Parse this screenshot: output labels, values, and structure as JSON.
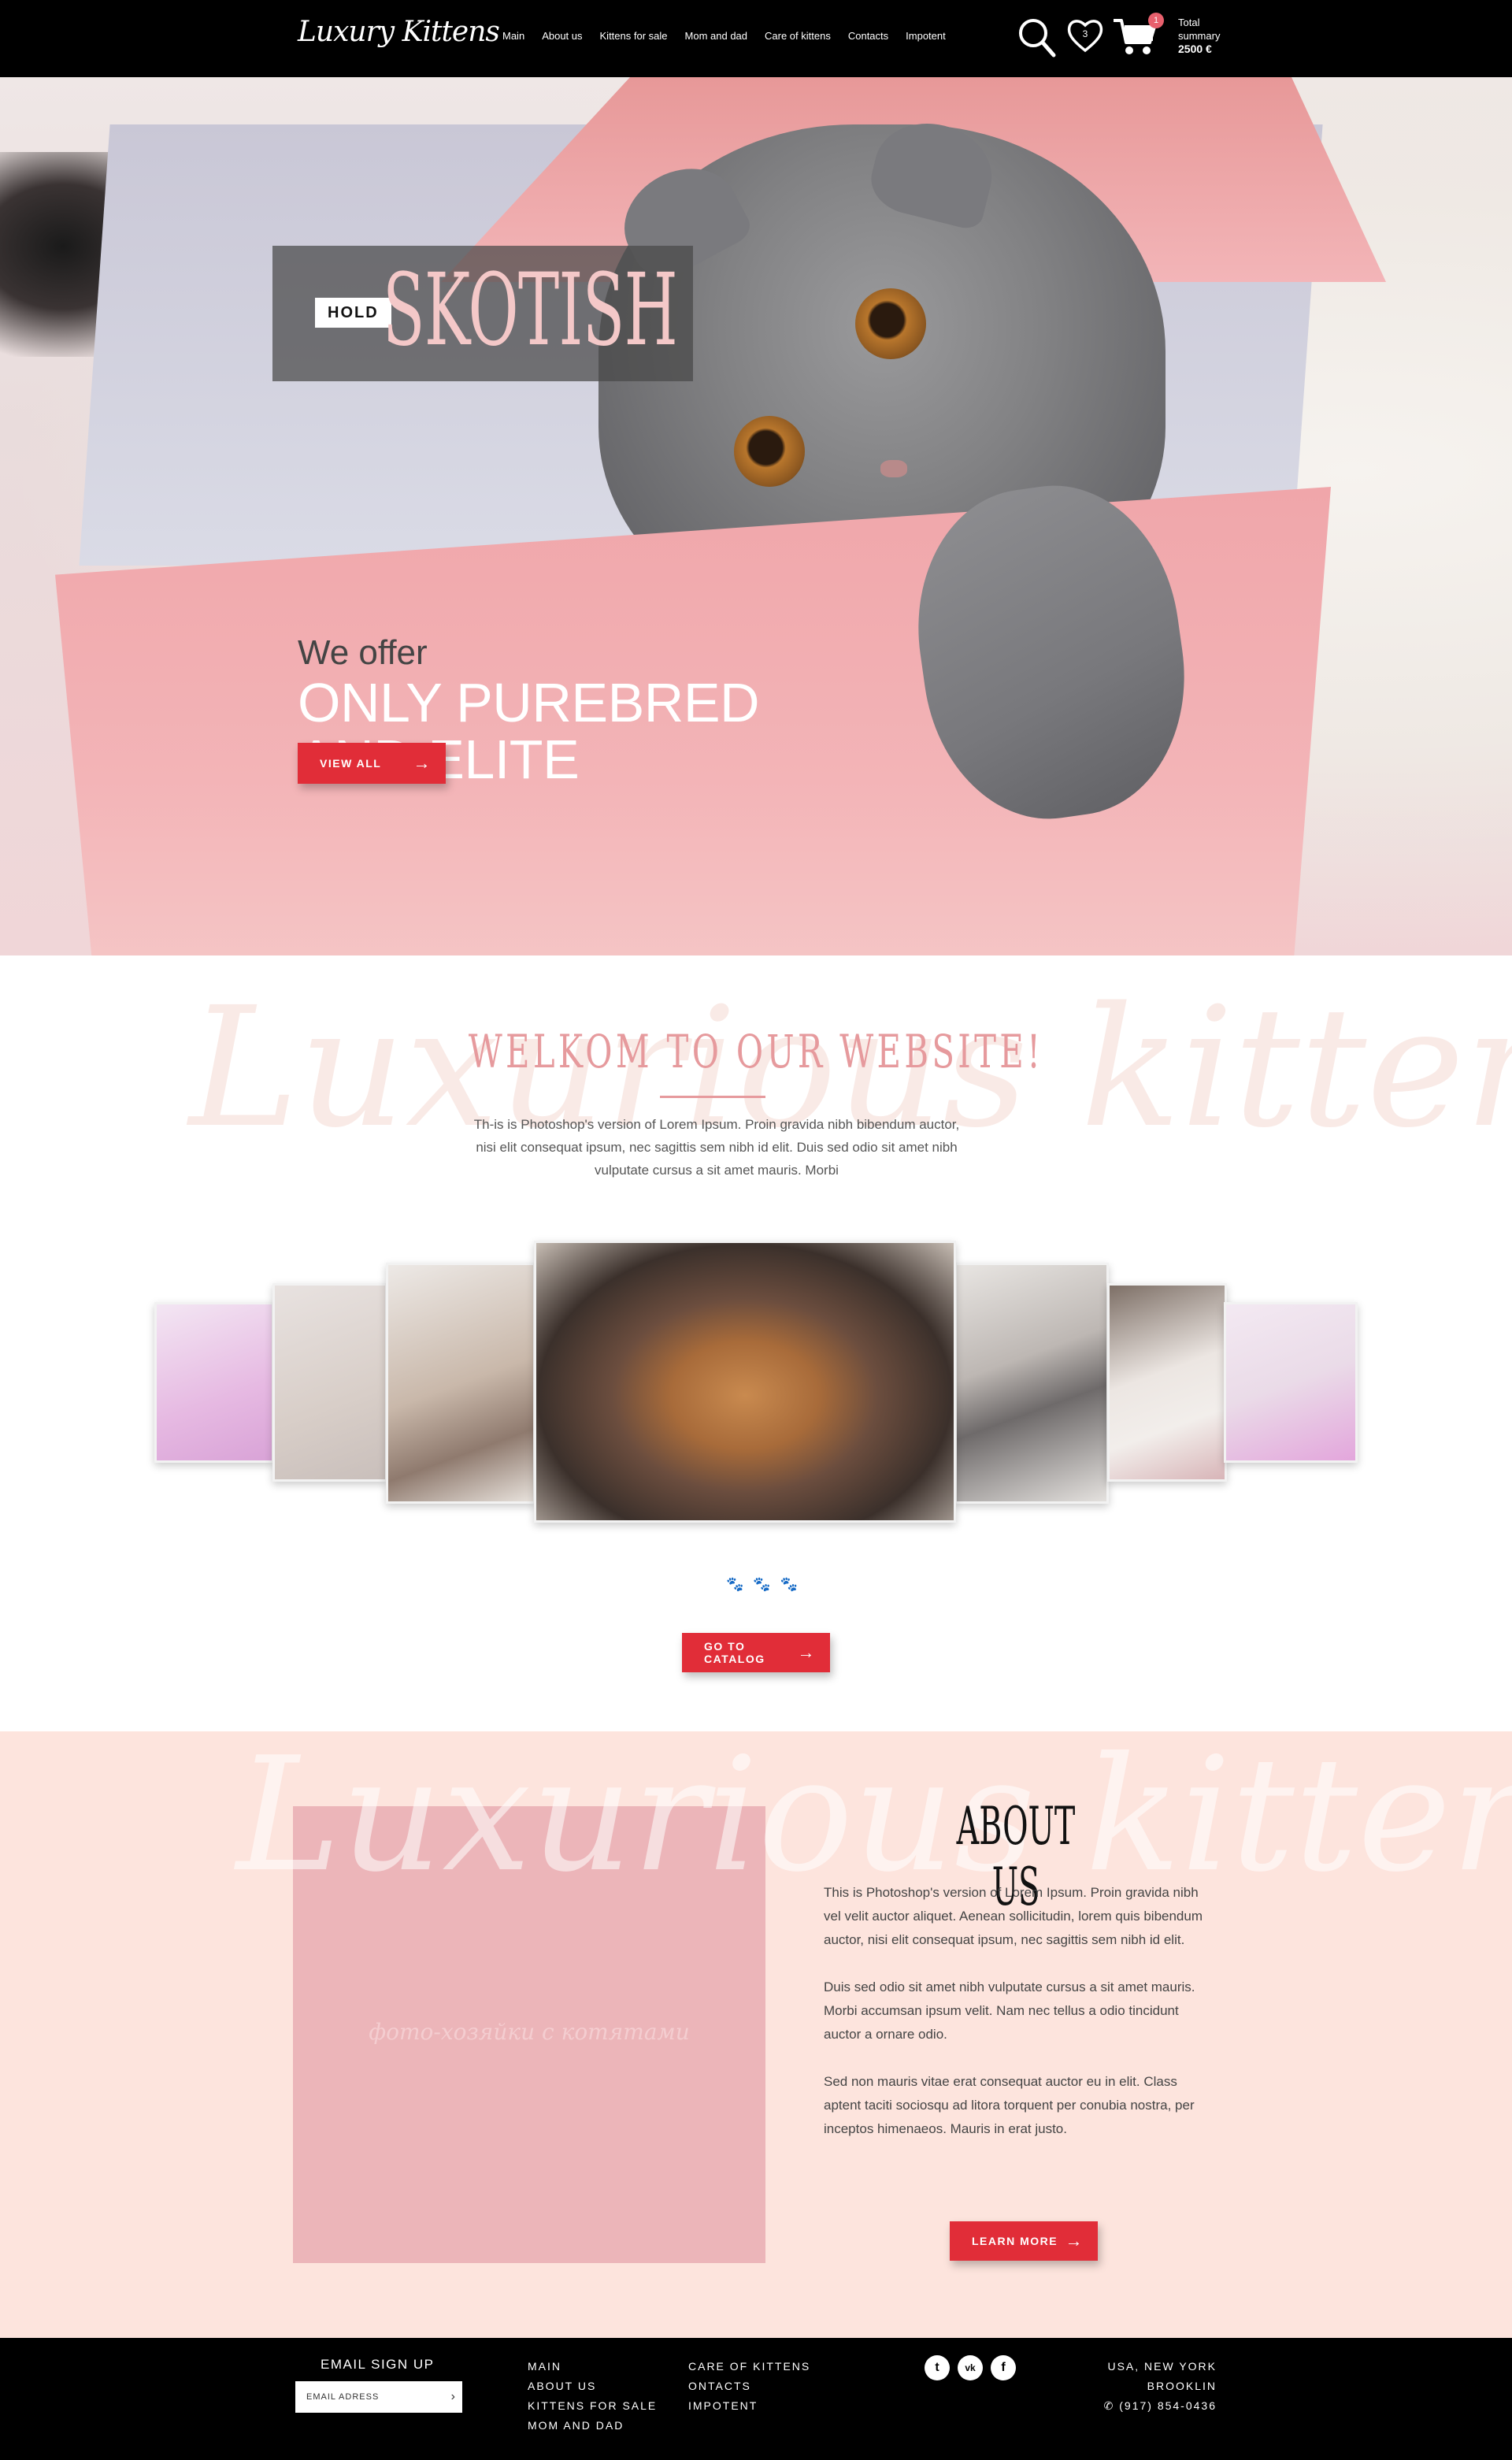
{
  "header": {
    "logo": "Luxury Kittens",
    "nav": [
      "Main",
      "About us",
      "Kittens for sale",
      "Mom and dad",
      "Care of kittens",
      "Contacts",
      "Impotent"
    ],
    "wishlist_count": "3",
    "cart_count": "1",
    "cart_total_label1": "Total",
    "cart_total_label2": "summary",
    "cart_total_value": "2500 €"
  },
  "hero": {
    "badge_small": "HOLD",
    "badge_big": "SKOTISH",
    "offer": "We offer",
    "headline_line1": "ONLY PUREBRED",
    "headline_line2": "AND ELITE",
    "button": "VIEW ALL"
  },
  "welcome": {
    "script_bg": "Luxurious kittens",
    "title": "WELKOM   TO OUR WEBSITE!",
    "text": "Th-is is Photoshop's version  of Lorem Ipsum. Proin gravida nibh bibendum auctor, nisi elit consequat ipsum, nec sagittis sem nibh id elit. Duis sed odio sit amet nibh vulputate cursus a sit amet mauris. Morbi",
    "button": "GO TO CATALOG"
  },
  "about": {
    "script_bg": "Luxurious kittens",
    "photo_caption": "фото-хозяйки с котятами",
    "title": "ABOUT US",
    "paragraphs": [
      "This is Photoshop's version  of Lorem Ipsum. Proin gravida nibh vel velit auctor aliquet. Aenean sollicitudin, lorem quis bibendum auctor, nisi elit consequat ipsum, nec sagittis sem nibh id elit.",
      "Duis sed odio sit amet nibh vulputate cursus a sit amet mauris. Morbi accumsan ipsum velit. Nam nec tellus a odio tincidunt auctor a ornare odio.",
      "Sed non  mauris vitae erat consequat auctor eu in elit. Class aptent taciti sociosqu ad litora torquent per conubia nostra, per inceptos himenaeos. Mauris in erat justo."
    ],
    "button": "LEARN MORE"
  },
  "footer": {
    "signup_label": "EMAIL SIGN UP",
    "email_placeholder": "EMAIL ADRESS",
    "col1": [
      "MAIN",
      "ABOUT US",
      "KITTENS FOR SALE",
      "MOM AND DAD"
    ],
    "col2": [
      "CARE OF KITTENS",
      "ONTACTS",
      "IMPOTENT"
    ],
    "social": [
      "twitter-icon",
      "vk-icon",
      "facebook-icon"
    ],
    "address_line1": "USA, NEW YORK",
    "address_line2": "BROOKLIN",
    "phone": "(917) 854-0436"
  },
  "colors": {
    "accent": "#e12d38",
    "pink_text": "#e69a9d",
    "about_bg": "#fde4dd",
    "photo_placeholder": "#ecb5b9"
  }
}
